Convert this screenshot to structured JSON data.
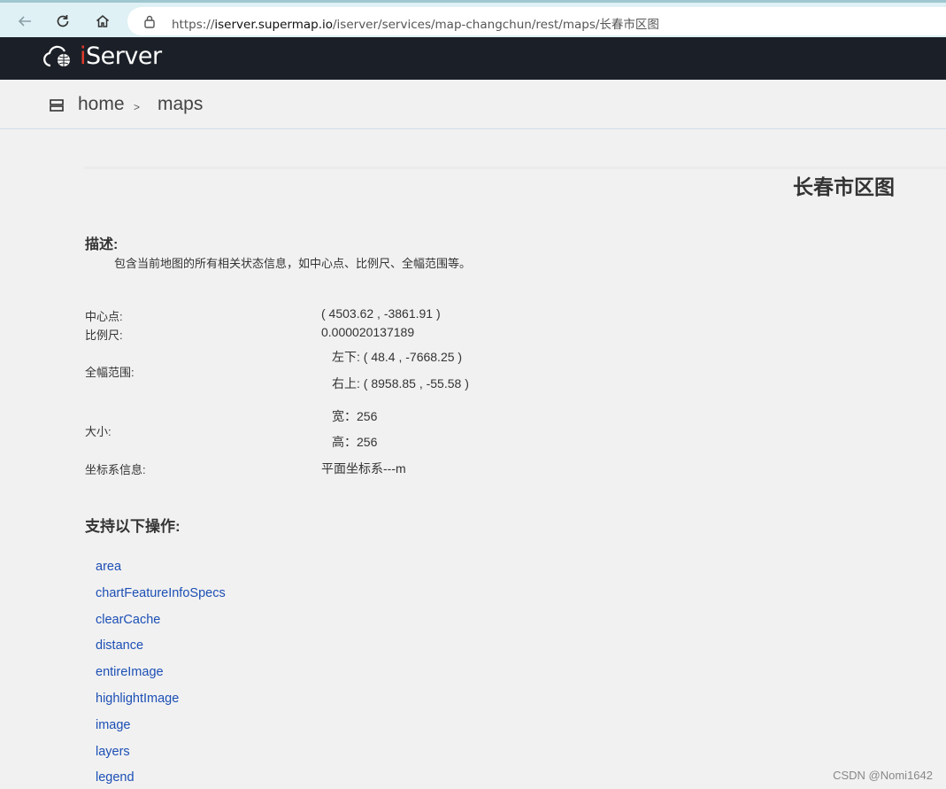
{
  "browser": {
    "url_prefix": "https://",
    "url_host": "iserver.supermap.io",
    "url_path": "/iserver/services/map-changchun/rest/maps/长春市区图"
  },
  "brand": {
    "logo_i": "i",
    "logo_rest": "Server"
  },
  "breadcrumb": {
    "home": "home",
    "sep": ">",
    "maps": "maps"
  },
  "map": {
    "title": "长春市区图",
    "description_heading": "描述:",
    "description": "包含当前地图的所有相关状态信息，如中心点、比例尺、全幅范围等。",
    "center_label": "中心点:",
    "center_value": "( 4503.62 , -3861.91 )",
    "scale_label": "比例尺:",
    "scale_value": "0.000020137189",
    "bounds_label": "全幅范围:",
    "bounds_lower_left": "左下:  ( 48.4 , -7668.25 )",
    "bounds_upper_right": "右上:  ( 8958.85 , -55.58 )",
    "size_label": "大小:",
    "size_width": "宽：256",
    "size_height": "高：256",
    "crs_label": "坐标系信息:",
    "crs_value": "平面坐标系---m"
  },
  "operations": {
    "heading": "支持以下操作:",
    "items": [
      "area",
      "chartFeatureInfoSpecs",
      "clearCache",
      "distance",
      "entireImage",
      "highlightImage",
      "image",
      "layers",
      "legend"
    ]
  },
  "watermark": "CSDN @Nomi1642",
  "colors": {
    "nav_bg": "#1b2028",
    "link": "#1c4fb5",
    "logo_accent": "#e23a2b"
  }
}
